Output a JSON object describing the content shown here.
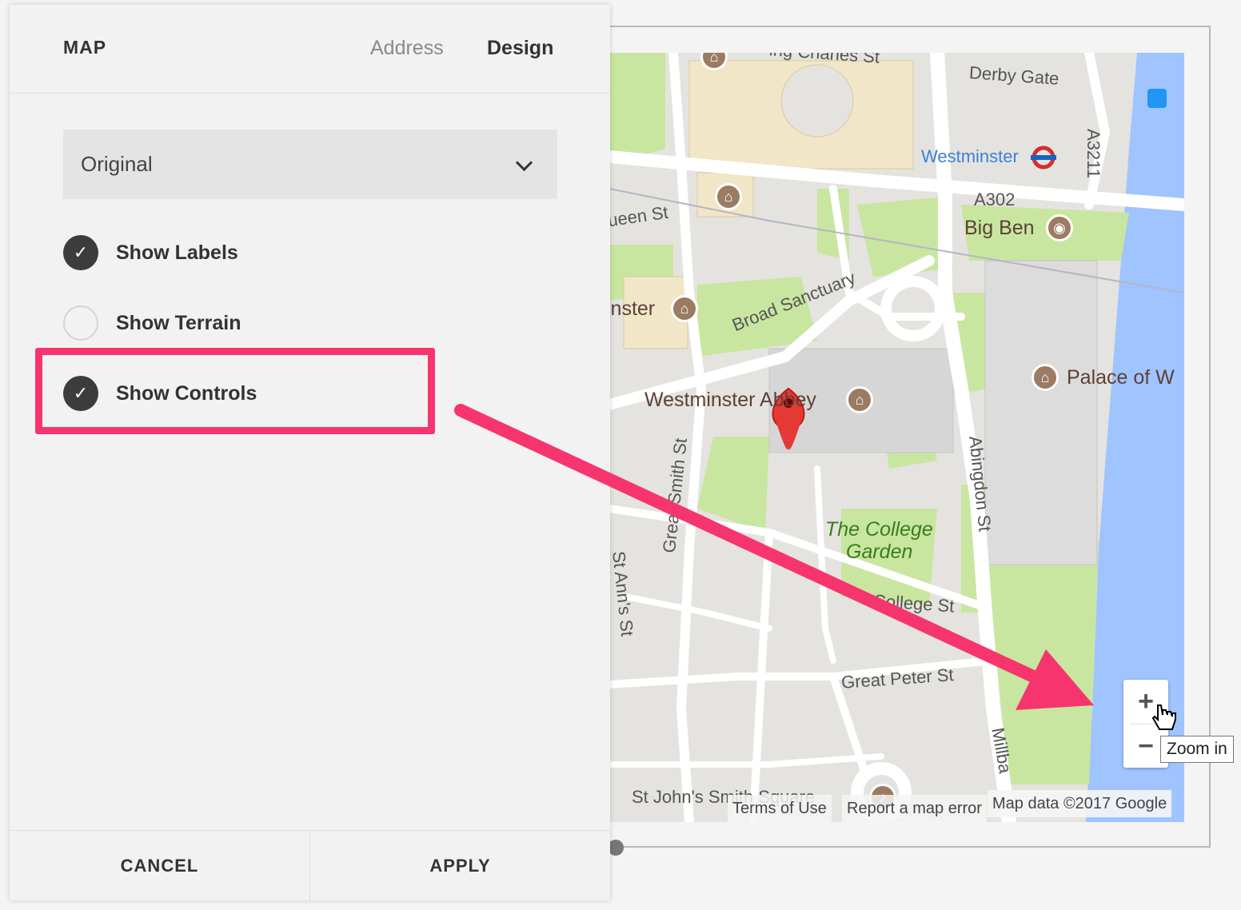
{
  "panel": {
    "title": "MAP",
    "tabs": [
      {
        "label": "Address",
        "active": false
      },
      {
        "label": "Design",
        "active": true
      }
    ],
    "style_select": {
      "value": "Original"
    },
    "options": [
      {
        "label": "Show Labels",
        "checked": true
      },
      {
        "label": "Show Terrain",
        "checked": false
      },
      {
        "label": "Show Controls",
        "checked": true
      }
    ],
    "footer": {
      "cancel_label": "CANCEL",
      "apply_label": "APPLY"
    }
  },
  "map": {
    "labels": {
      "charles_st": "ing Charles St",
      "derby_gate": "Derby Gate",
      "westminster_station": "Westminster",
      "a3211": "A3211",
      "a302": "A302",
      "queen_st": "ueen St",
      "big_ben": "Big Ben",
      "minster": "inster",
      "broad_sanctuary": "Broad Sanctuary",
      "palace": "Palace of W",
      "abbey": "Westminster Abbey",
      "great_smith_st": "Great Smith St",
      "abingdon_st": "Abingdon St",
      "college_garden_1": "The College",
      "college_garden_2": "Garden",
      "college_st": "College St",
      "st_anns_st": "St Ann's St",
      "great_peter_st": "Great Peter St",
      "millbank": "Millba",
      "st_johns": "St John's Smith Square"
    },
    "attribution": {
      "terms": "Terms of Use",
      "report": "Report a map error",
      "map_data": "Map data ©2017 Google"
    },
    "zoom": {
      "plus": "+",
      "minus": "−",
      "tooltip": "Zoom in"
    }
  },
  "colors": {
    "highlight": "#f6356f",
    "park": "#c8e6a0",
    "water": "#a0c4ff",
    "marker": "#e53935"
  }
}
